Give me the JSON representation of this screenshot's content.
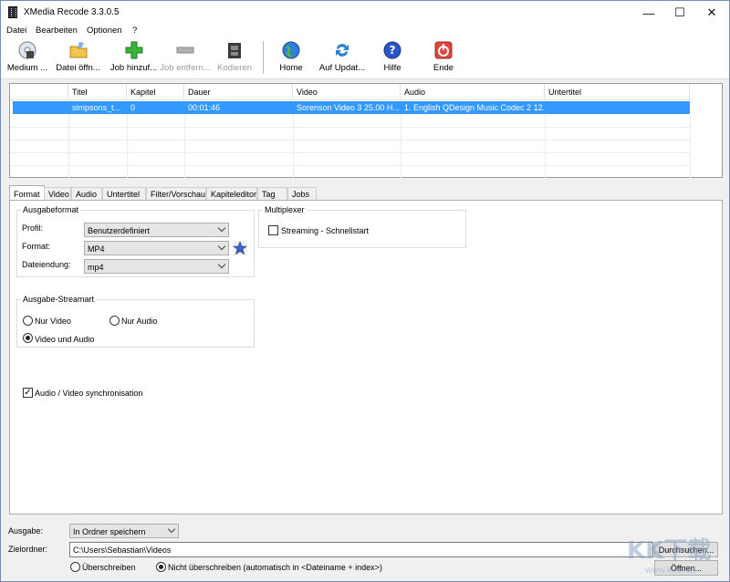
{
  "window": {
    "title": "XMedia Recode 3.3.0.5"
  },
  "menu": [
    "Datei",
    "Bearbeiten",
    "Optionen",
    "?"
  ],
  "toolbar": {
    "open_media": "Medium ...",
    "open_file": "Datei öffn...",
    "add_job": "Job hinzuf...",
    "remove_job": "Job entfern...",
    "encode": "Kodieren",
    "home": "Home",
    "update": "Auf Updat...",
    "help": "Hilfe",
    "exit": "Ende"
  },
  "filelist": {
    "columns": [
      "Titel",
      "Kapitel",
      "Dauer",
      "Video",
      "Audio",
      "Untertitel"
    ],
    "rows": [
      {
        "title": "simpsons_t...",
        "chapter": "0",
        "duration": "00:01:46",
        "video": "Sorenson Video 3 25.00 H...",
        "audio": "1. English QDesign Music Codec 2 12...",
        "subtitle": ""
      }
    ]
  },
  "tabs": [
    "Format",
    "Video",
    "Audio",
    "Untertitel",
    "Filter/Vorschau",
    "Kapiteleditor",
    "Tag",
    "Jobs"
  ],
  "format_tab": {
    "output_format_group": "Ausgabeformat",
    "profile_label": "Profil:",
    "profile_value": "Benutzerdefiniert",
    "format_label": "Format:",
    "format_value": "MP4",
    "extension_label": "Dateiendung:",
    "extension_value": "mp4",
    "multiplexer_group": "Multiplexer",
    "streaming_label": "Streaming - Schnellstart",
    "stream_group": "Ausgabe-Streamart",
    "only_video": "Nur Video",
    "only_audio": "Nur Audio",
    "video_and_audio": "Video und Audio",
    "av_sync": "Audio / Video synchronisation"
  },
  "output": {
    "label": "Ausgabe:",
    "value": "In Ordner speichern",
    "dest_label": "Zielordner:",
    "dest_value": "C:\\Users\\Sebastian\\Videos",
    "browse": "Durchsuchen...",
    "overwrite": "Überschreiben",
    "no_overwrite": "Nicht überschreiben (automatisch in <Dateiname + index>)",
    "open": "Öffnen..."
  },
  "watermark": {
    "text": "KK下载",
    "url": "www.kkx.net"
  },
  "colors": {
    "selection": "#3399ff",
    "add": "#3bb33b",
    "help": "#2a55c8",
    "exit": "#e0443b"
  }
}
